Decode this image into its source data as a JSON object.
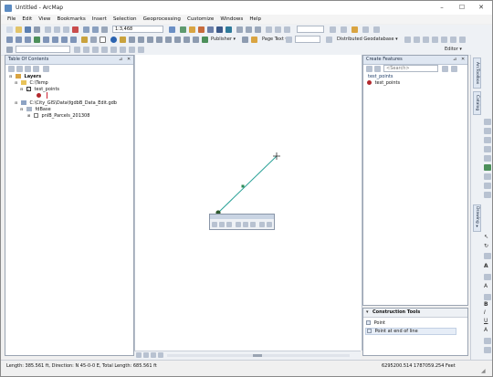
{
  "window": {
    "title": "Untitled - ArcMap",
    "controls": [
      "–",
      "☐",
      "✕"
    ]
  },
  "menu": [
    "File",
    "Edit",
    "View",
    "Bookmarks",
    "Insert",
    "Selection",
    "Geoprocessing",
    "Customize",
    "Windows",
    "Help"
  ],
  "toolbar": {
    "scale": "1:3,468",
    "publisher_label": "Publisher ▾",
    "page_text_label": "Page Text ▾",
    "geodatabase_label": "Distributed Geodatabase ▾",
    "editor_label": "Editor ▾"
  },
  "toc": {
    "title": "Table Of Contents",
    "items": [
      {
        "label": "Layers"
      },
      {
        "label": "C:\\Temp"
      },
      {
        "label": "test_points"
      },
      {
        "label": "C:\\City_GIS\\Data\\fgdbB_Data_Edit.gdb"
      },
      {
        "label": "fdBase"
      },
      {
        "label": "pnlB_Parcels_201308"
      }
    ]
  },
  "create_features": {
    "title": "Create Features",
    "search_placeholder": "<Search>",
    "group_label": "test_points",
    "template_label": "test_points"
  },
  "construction_tools": {
    "title": "Construction Tools",
    "items": [
      "Point",
      "Point at end of line"
    ]
  },
  "side_tabs": [
    "ArcToolbox",
    "Catalog",
    "Drawing ▾"
  ],
  "status": {
    "left": "Length: 385.561 ft, Direction: N 45-0-0 E, Total Length: 685.561 ft",
    "coords": "6295200.514  1787059.254 Feet"
  },
  "colors": {
    "point_red": "#b3282d",
    "point_green": "#2e8b57",
    "line": "#2aa197",
    "accent": "#dfe7f2"
  }
}
